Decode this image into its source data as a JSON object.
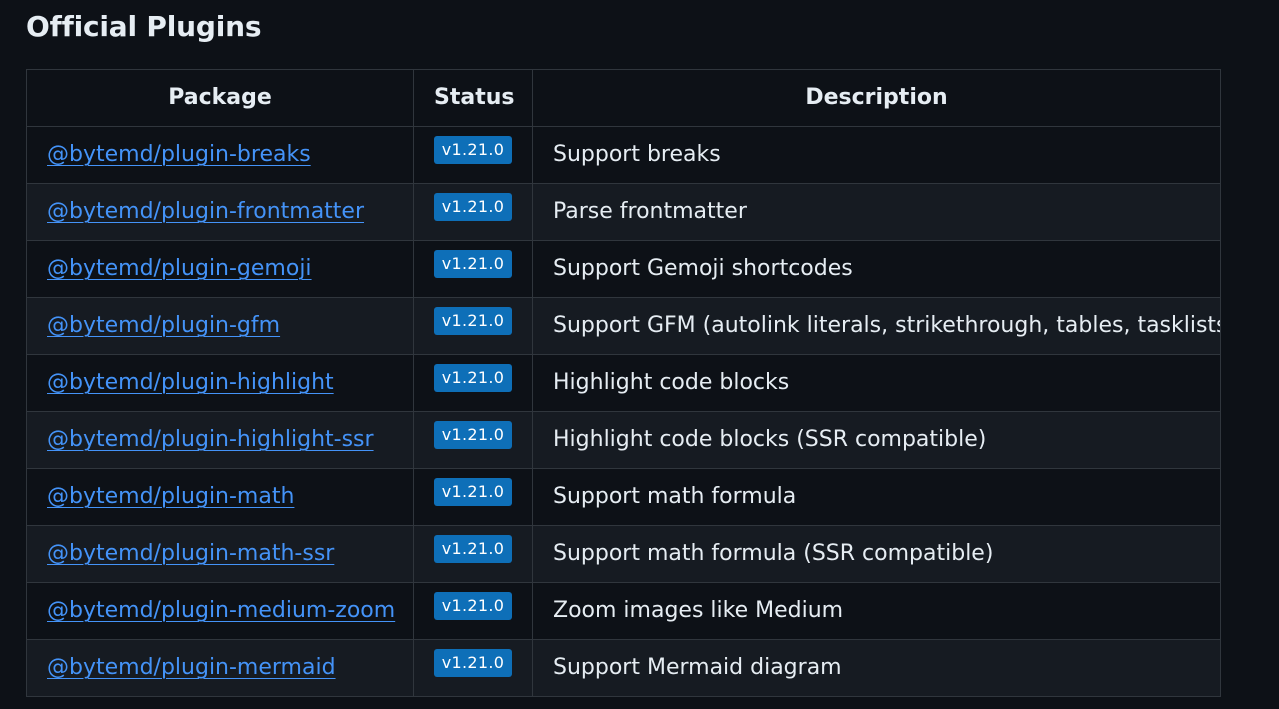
{
  "section": {
    "title": "Official Plugins"
  },
  "table": {
    "headers": {
      "package": "Package",
      "status": "Status",
      "description": "Description"
    },
    "rows": [
      {
        "package": "@bytemd/plugin-breaks",
        "status": "v1.21.0",
        "description": "Support breaks"
      },
      {
        "package": "@bytemd/plugin-frontmatter",
        "status": "v1.21.0",
        "description": "Parse frontmatter"
      },
      {
        "package": "@bytemd/plugin-gemoji",
        "status": "v1.21.0",
        "description": "Support Gemoji shortcodes"
      },
      {
        "package": "@bytemd/plugin-gfm",
        "status": "v1.21.0",
        "description": "Support GFM (autolink literals, strikethrough, tables, tasklists)"
      },
      {
        "package": "@bytemd/plugin-highlight",
        "status": "v1.21.0",
        "description": "Highlight code blocks"
      },
      {
        "package": "@bytemd/plugin-highlight-ssr",
        "status": "v1.21.0",
        "description": "Highlight code blocks (SSR compatible)"
      },
      {
        "package": "@bytemd/plugin-math",
        "status": "v1.21.0",
        "description": "Support math formula"
      },
      {
        "package": "@bytemd/plugin-math-ssr",
        "status": "v1.21.0",
        "description": "Support math formula (SSR compatible)"
      },
      {
        "package": "@bytemd/plugin-medium-zoom",
        "status": "v1.21.0",
        "description": "Zoom images like Medium"
      },
      {
        "package": "@bytemd/plugin-mermaid",
        "status": "v1.21.0",
        "description": "Support Mermaid diagram"
      }
    ]
  },
  "colors": {
    "background": "#0d1117",
    "row_alt": "#161b22",
    "border": "#30363d",
    "link": "#4493f8",
    "badge": "#0e6fb8",
    "text": "#e6edf3"
  }
}
